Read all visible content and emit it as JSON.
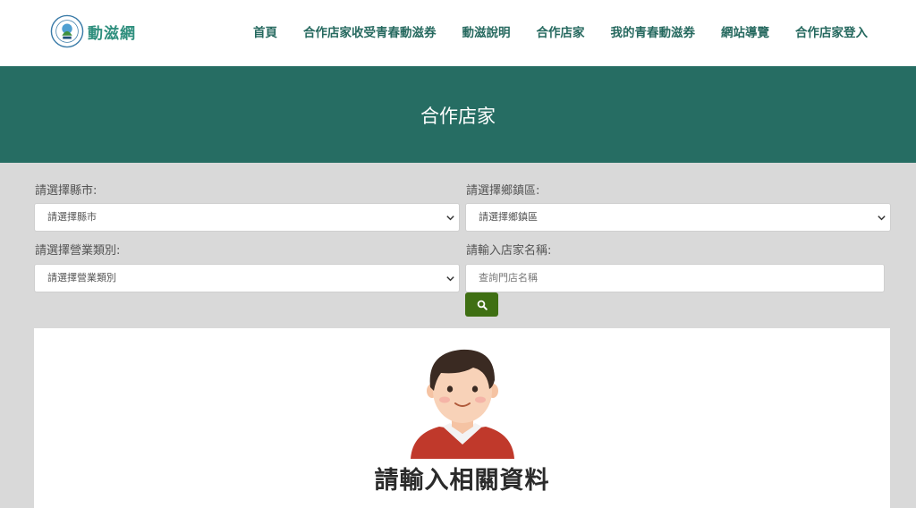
{
  "header": {
    "logo_text": "動滋網",
    "nav": [
      "首頁",
      "合作店家收受青春動滋券",
      "動滋說明",
      "合作店家",
      "我的青春動滋券",
      "網站導覽",
      "合作店家登入"
    ]
  },
  "banner": {
    "title": "合作店家"
  },
  "filters": {
    "city": {
      "label": "請選擇縣市:",
      "value": "請選擇縣市"
    },
    "district": {
      "label": "請選擇鄉鎮區:",
      "value": "請選擇鄉鎮區"
    },
    "category": {
      "label": "請選擇營業類別:",
      "value": "請選擇營業類別"
    },
    "store_name": {
      "label": "請輸入店家名稱:",
      "placeholder": "查詢門店名稱"
    }
  },
  "search_icon": "search-icon",
  "card": {
    "title": "請輸入相關資料",
    "avatar_icon": "person-avatar"
  },
  "colors": {
    "brand": "#266d63",
    "nav_text": "#26695f",
    "search_button": "#3f6f13",
    "page_bg": "#d9d9d9"
  }
}
